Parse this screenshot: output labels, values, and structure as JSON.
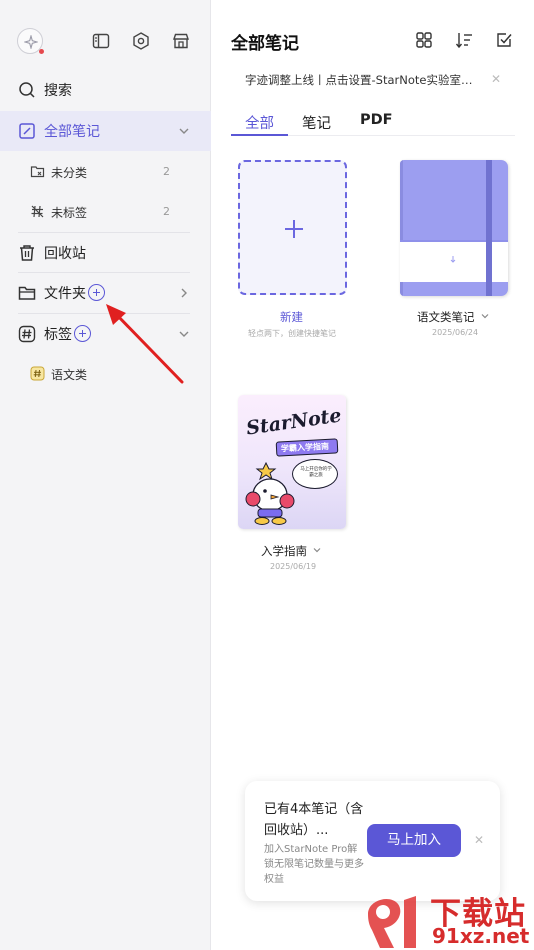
{
  "sidebar": {
    "search_label": "搜索",
    "all_notes_label": "全部笔记",
    "uncategorized": {
      "label": "未分类",
      "count": "2"
    },
    "untagged": {
      "label": "未标签",
      "count": "2"
    },
    "trash_label": "回收站",
    "folder_label": "文件夹",
    "tags_label": "标签",
    "tag_items": [
      {
        "label": "语文类"
      }
    ]
  },
  "header": {
    "title": "全部笔记",
    "banner_text": "字迹调整上线丨点击设置-StarNote实验室开启"
  },
  "tabs": [
    {
      "label": "全部",
      "active": true
    },
    {
      "label": "笔记",
      "active": false
    },
    {
      "label": "PDF",
      "active": false
    }
  ],
  "cards": {
    "new": {
      "title": "新建",
      "subtitle": "轻点两下，创建快捷笔记"
    },
    "notebook1": {
      "title": "语文类笔记",
      "date": "2025/06/24"
    },
    "notebook2": {
      "title": "入学指南",
      "date": "2025/06/19",
      "cover_logo": "StarNote",
      "cover_subtitle": "学霸入学指南",
      "cover_bubble": "马上开启你的学霸之旅"
    }
  },
  "promo": {
    "title": "已有4本笔记（含回收站）...",
    "description": "加入StarNote Pro解锁无限笔记数量与更多权益",
    "button_label": "马上加入"
  },
  "watermark": {
    "brand": "下载站",
    "domain": "91xz.net"
  },
  "colors": {
    "accent": "#5b57d6",
    "sidebar_bg": "#f4f4f6",
    "notebook_cover": "#9c9ef0",
    "arrow": "#e02020"
  }
}
